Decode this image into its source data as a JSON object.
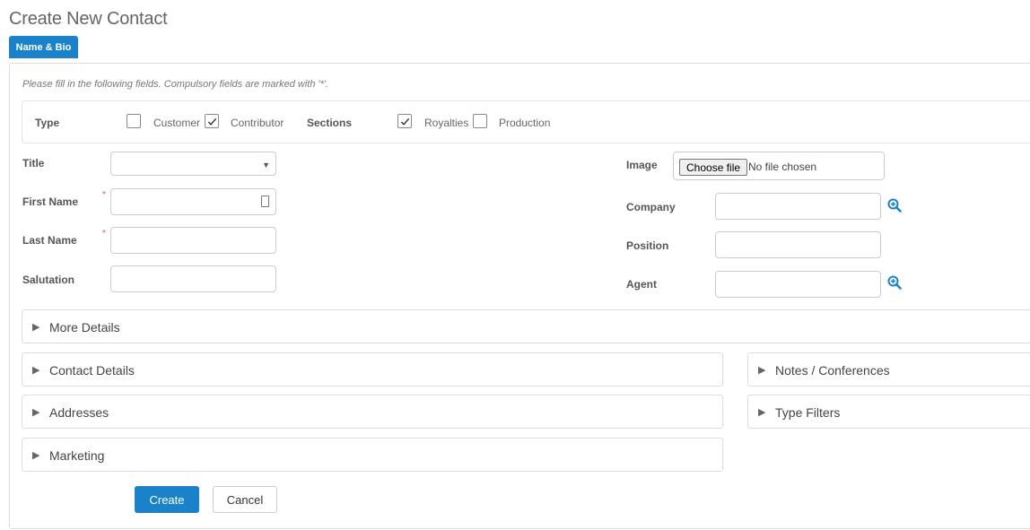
{
  "page": {
    "title": "Create New Contact"
  },
  "tabs": [
    {
      "label": "Name & Bio",
      "active": true
    }
  ],
  "form": {
    "instructions": "Please fill in the following fields. Compulsory fields are marked with '*'.",
    "type": {
      "label": "Type",
      "options": [
        {
          "label": "Customer",
          "checked": false
        },
        {
          "label": "Contributor",
          "checked": true
        }
      ]
    },
    "sections_group": {
      "label": "Sections",
      "options": [
        {
          "label": "Royalties",
          "checked": true
        },
        {
          "label": "Production",
          "checked": false
        }
      ]
    },
    "fields": {
      "title": {
        "label": "Title",
        "value": ""
      },
      "first_name": {
        "label": "First Name",
        "required_mark": "*",
        "value": ""
      },
      "last_name": {
        "label": "Last Name",
        "required_mark": "*",
        "value": ""
      },
      "salutation": {
        "label": "Salutation",
        "value": ""
      },
      "image": {
        "label": "Image",
        "button": "Choose file",
        "status": "No file chosen"
      },
      "company": {
        "label": "Company",
        "value": ""
      },
      "position": {
        "label": "Position",
        "value": ""
      },
      "agent": {
        "label": "Agent",
        "value": ""
      }
    },
    "panels": {
      "more_details": "More Details",
      "contact_details": "Contact Details",
      "addresses": "Addresses",
      "marketing": "Marketing",
      "notes_conferences": "Notes / Conferences",
      "type_filters": "Type Filters"
    },
    "actions": {
      "create": "Create",
      "cancel": "Cancel"
    }
  },
  "colors": {
    "primary": "#1a82c8",
    "required": "#d9534f",
    "lookup_icon": "#1a82c8"
  },
  "icons": {
    "panel_toggle": "triangle-right-icon",
    "lookup": "zoom-in-icon",
    "check": "check-icon"
  }
}
